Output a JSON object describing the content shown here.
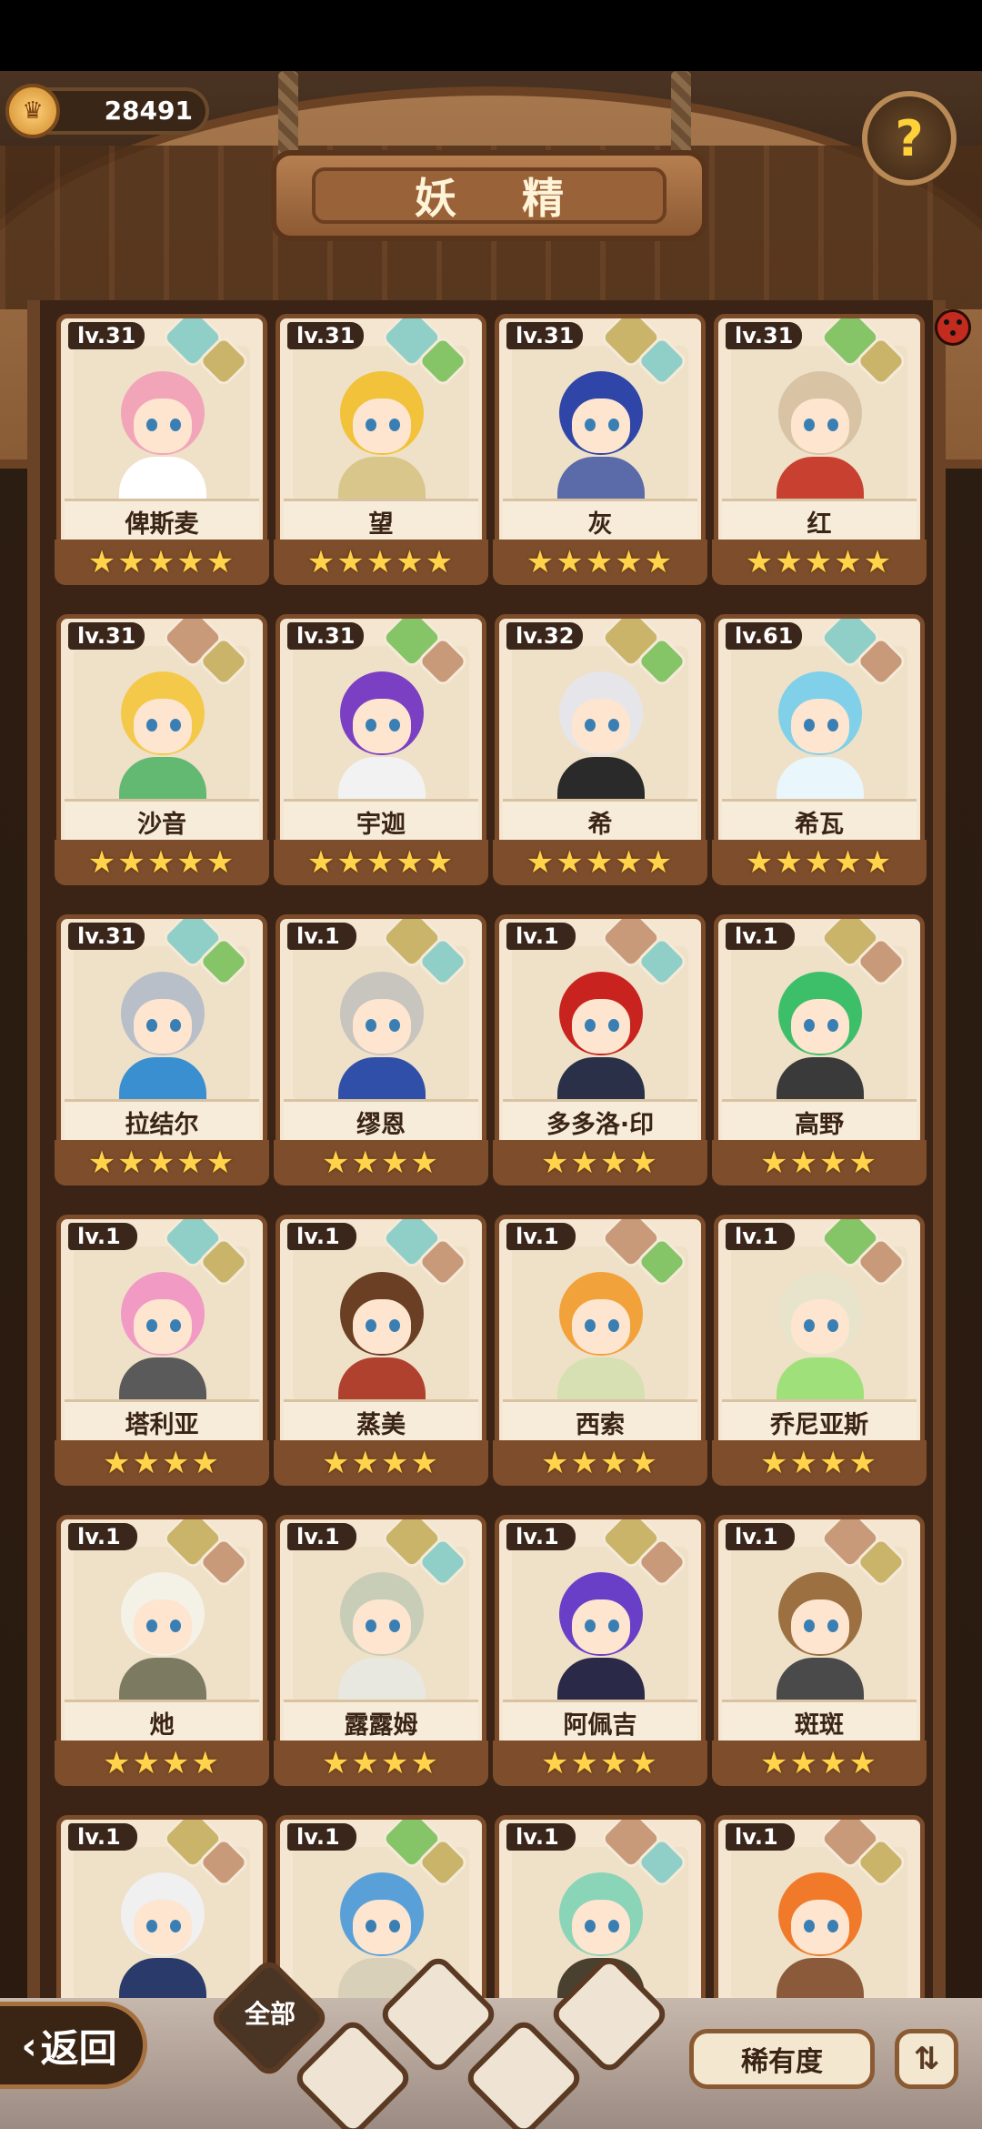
{
  "header": {
    "title": "妖 精",
    "currency_value": "28491"
  },
  "colors": {
    "water": "#8fcfc8",
    "earth": "#c9b46a",
    "plant": "#86c468",
    "mountain": "#c99a7a",
    "star": "#ffd34a"
  },
  "cards": [
    {
      "level": "lv.31",
      "name": "俾斯麦",
      "stars": "★★★★★",
      "elements": [
        "water",
        "earth"
      ],
      "hair": "#f2a5b8",
      "outfit": "#ffffff"
    },
    {
      "level": "lv.31",
      "name": "望",
      "stars": "★★★★★",
      "elements": [
        "water",
        "plant"
      ],
      "hair": "#f1c23a",
      "outfit": "#d8c68a"
    },
    {
      "level": "lv.31",
      "name": "灰",
      "stars": "★★★★★",
      "elements": [
        "earth",
        "water"
      ],
      "hair": "#2f45a8",
      "outfit": "#5b6aa8"
    },
    {
      "level": "lv.31",
      "name": "红",
      "stars": "★★★★★",
      "elements": [
        "plant",
        "earth"
      ],
      "hair": "#d8c4a4",
      "outfit": "#c8402f"
    },
    {
      "level": "lv.31",
      "name": "沙音",
      "stars": "★★★★★",
      "elements": [
        "mountain",
        "earth"
      ],
      "hair": "#f4c94a",
      "outfit": "#63b872"
    },
    {
      "level": "lv.31",
      "name": "宇迦",
      "stars": "★★★★★",
      "elements": [
        "plant",
        "mountain"
      ],
      "hair": "#7a3fc2",
      "outfit": "#f2f2f2"
    },
    {
      "level": "lv.32",
      "name": "希",
      "stars": "★★★★★",
      "elements": [
        "earth",
        "plant"
      ],
      "hair": "#e6e6ea",
      "outfit": "#2a2a2a"
    },
    {
      "level": "lv.61",
      "name": "希瓦",
      "stars": "★★★★★",
      "elements": [
        "water",
        "mountain"
      ],
      "hair": "#7fd0e8",
      "outfit": "#e9f6fb"
    },
    {
      "level": "lv.31",
      "name": "拉结尔",
      "stars": "★★★★★",
      "elements": [
        "water",
        "plant"
      ],
      "hair": "#b9bfc8",
      "outfit": "#3a8fd0"
    },
    {
      "level": "lv.1",
      "name": "缪恩",
      "stars": "★★★★",
      "elements": [
        "earth",
        "water"
      ],
      "hair": "#c8c4be",
      "outfit": "#2f4fa8"
    },
    {
      "level": "lv.1",
      "name": "多多洛·印",
      "stars": "★★★★",
      "elements": [
        "mountain",
        "water"
      ],
      "hair": "#c8231e",
      "outfit": "#2a3048"
    },
    {
      "level": "lv.1",
      "name": "高野",
      "stars": "★★★★",
      "elements": [
        "earth",
        "mountain"
      ],
      "hair": "#3dbf6a",
      "outfit": "#3a3a3a"
    },
    {
      "level": "lv.1",
      "name": "塔利亚",
      "stars": "★★★★",
      "elements": [
        "water",
        "earth"
      ],
      "hair": "#f09ac4",
      "outfit": "#5a5a5a"
    },
    {
      "level": "lv.1",
      "name": "蒸美",
      "stars": "★★★★",
      "elements": [
        "water",
        "mountain"
      ],
      "hair": "#6a3f24",
      "outfit": "#b0412f"
    },
    {
      "level": "lv.1",
      "name": "西索",
      "stars": "★★★★",
      "elements": [
        "mountain",
        "plant"
      ],
      "hair": "#f2a23a",
      "outfit": "#d7e0b2"
    },
    {
      "level": "lv.1",
      "name": "乔尼亚斯",
      "stars": "★★★★",
      "elements": [
        "plant",
        "mountain"
      ],
      "hair": "#e8e4cc",
      "outfit": "#9fe07a"
    },
    {
      "level": "lv.1",
      "name": "灺",
      "stars": "★★★★",
      "elements": [
        "earth",
        "mountain"
      ],
      "hair": "#f4f1e6",
      "outfit": "#7d7a62"
    },
    {
      "level": "lv.1",
      "name": "露露姆",
      "stars": "★★★★",
      "elements": [
        "earth",
        "water"
      ],
      "hair": "#c8cdb8",
      "outfit": "#e8e8e0"
    },
    {
      "level": "lv.1",
      "name": "阿佩吉",
      "stars": "★★★★",
      "elements": [
        "earth",
        "mountain"
      ],
      "hair": "#6a3fc8",
      "outfit": "#2a2a48"
    },
    {
      "level": "lv.1",
      "name": "斑斑",
      "stars": "★★★★",
      "elements": [
        "mountain",
        "earth"
      ],
      "hair": "#9c7040",
      "outfit": "#4a4a4a"
    },
    {
      "level": "lv.1",
      "name": "",
      "stars": "",
      "elements": [
        "earth",
        "mountain"
      ],
      "hair": "#f0f0f0",
      "outfit": "#2a3a6a"
    },
    {
      "level": "lv.1",
      "name": "",
      "stars": "",
      "elements": [
        "plant",
        "earth"
      ],
      "hair": "#5aa0d8",
      "outfit": "#d8d0b8"
    },
    {
      "level": "lv.1",
      "name": "",
      "stars": "",
      "elements": [
        "mountain",
        "water"
      ],
      "hair": "#8ad4b8",
      "outfit": "#4a4030"
    },
    {
      "level": "lv.1",
      "name": "",
      "stars": "",
      "elements": [
        "mountain",
        "earth"
      ],
      "hair": "#f07a2a",
      "outfit": "#8a5a3a"
    }
  ],
  "bottom": {
    "back_label": "返回",
    "filter_all_label": "全部",
    "rarity_label": "稀有度",
    "sort_icon": "sort-icon"
  }
}
